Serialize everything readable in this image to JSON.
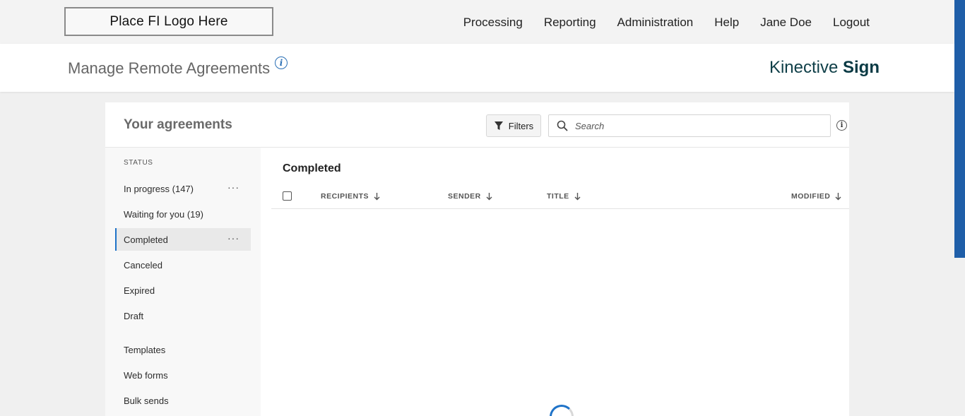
{
  "header": {
    "logo_text": "Place FI Logo Here",
    "nav": [
      "Processing",
      "Reporting",
      "Administration",
      "Help",
      "Jane Doe",
      "Logout"
    ]
  },
  "subheader": {
    "page_title": "Manage Remote Agreements",
    "brand_light": "Kinective",
    "brand_bold": "Sign"
  },
  "card": {
    "title": "Your agreements",
    "filters_label": "Filters",
    "search_placeholder": "Search"
  },
  "sidebar": {
    "status_label": "STATUS",
    "status_items": [
      {
        "label": "In progress (147)",
        "has_menu": true
      },
      {
        "label": "Waiting for you (19)",
        "has_menu": false
      },
      {
        "label": "Completed",
        "has_menu": true,
        "active": true
      },
      {
        "label": "Canceled",
        "has_menu": false
      },
      {
        "label": "Expired",
        "has_menu": false
      },
      {
        "label": "Draft",
        "has_menu": false
      }
    ],
    "other_items": [
      "Templates",
      "Web forms",
      "Bulk sends"
    ],
    "more_glyph": "···"
  },
  "main": {
    "section_title": "Completed",
    "columns": [
      "RECIPIENTS",
      "SENDER",
      "TITLE",
      "MODIFIED"
    ]
  },
  "colors": {
    "accent": "#1f73c8",
    "brand": "#0f3f48",
    "scrollbar": "#1f5ea8"
  },
  "icons": {
    "info": "info-icon",
    "filter": "filter-icon",
    "search": "search-icon",
    "sort": "arrow-down-icon",
    "more": "ellipsis-icon",
    "loading": "spinner-icon"
  }
}
